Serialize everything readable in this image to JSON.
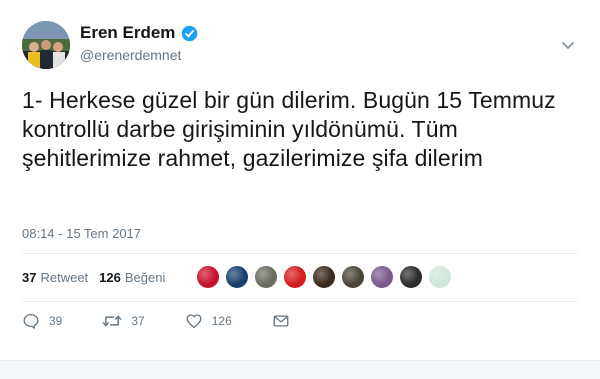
{
  "tweet": {
    "author_name": "Eren Erdem",
    "handle": "@erenerdemnet",
    "text": "1- Herkese güzel bir gün dilerim. Bugün 15 Temmuz kontrollü darbe girişiminin yıldönümü. Tüm şehitlerimize rahmet, gazilerimize şifa dilerim",
    "timestamp": "08:14 - 15 Tem 2017",
    "retweet_count": "37",
    "retweet_label": "Retweet",
    "like_count": "126",
    "like_label": "Beğeni",
    "reply_count": "39",
    "action_retweet_count": "37",
    "action_like_count": "126"
  },
  "icons": {
    "verified": "verified-badge-icon",
    "caret": "chevron-down-icon",
    "reply": "reply-icon",
    "retweet": "retweet-icon",
    "like": "heart-icon",
    "dm": "envelope-icon"
  },
  "colors": {
    "verified": "#1da1f2",
    "text_primary": "#14171a",
    "text_secondary": "#657786",
    "divider": "#e6ecf0"
  },
  "liker_avatars": [
    {
      "color": "#c8102e"
    },
    {
      "color": "#1b3f6e"
    },
    {
      "color": "#6b6b60"
    },
    {
      "color": "#d41c1c"
    },
    {
      "color": "#3a2a1c"
    },
    {
      "color": "#4a4438"
    },
    {
      "color": "#7a5a8a"
    },
    {
      "color": "#2b2b2b"
    },
    {
      "color": "#cfe6d8"
    }
  ]
}
